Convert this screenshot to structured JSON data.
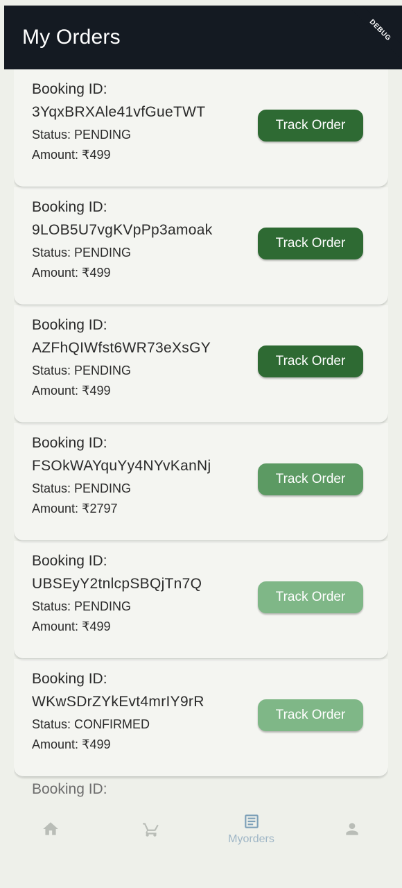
{
  "appbar": {
    "title": "My Orders",
    "debug_banner": "DEBUG"
  },
  "orders": [
    {
      "label": "Booking ID:",
      "id": "3YqxBRXAle41vfGueTWT",
      "status": "Status: PENDING",
      "amount": "Amount: ₹499",
      "button": "Track Order"
    },
    {
      "label": "Booking ID:",
      "id": "9LOB5U7vgKVpPp3amoak",
      "status": "Status: PENDING",
      "amount": "Amount: ₹499",
      "button": "Track Order"
    },
    {
      "label": "Booking ID:",
      "id": "AZFhQIWfst6WR73eXsGY",
      "status": "Status: PENDING",
      "amount": "Amount: ₹499",
      "button": "Track Order"
    },
    {
      "label": "Booking ID:",
      "id": "FSOkWAYquYy4NYvKanNj",
      "status": "Status: PENDING",
      "amount": "Amount: ₹2797",
      "button": "Track Order"
    },
    {
      "label": "Booking ID:",
      "id": "UBSEyY2tnlcpSBQjTn7Q",
      "status": "Status: PENDING",
      "amount": "Amount: ₹499",
      "button": "Track Order"
    },
    {
      "label": "Booking ID:",
      "id": "WKwSDrZYkEvt4mrIY9rR",
      "status": "Status: CONFIRMED",
      "amount": "Amount: ₹499",
      "button": "Track Order"
    }
  ],
  "partial_label": "Booking ID:",
  "bottom_nav": {
    "items": [
      {
        "icon": "home-icon",
        "label": ""
      },
      {
        "icon": "cart-icon",
        "label": ""
      },
      {
        "icon": "orders-icon",
        "label": "Myorders"
      },
      {
        "icon": "person-icon",
        "label": ""
      }
    ]
  }
}
